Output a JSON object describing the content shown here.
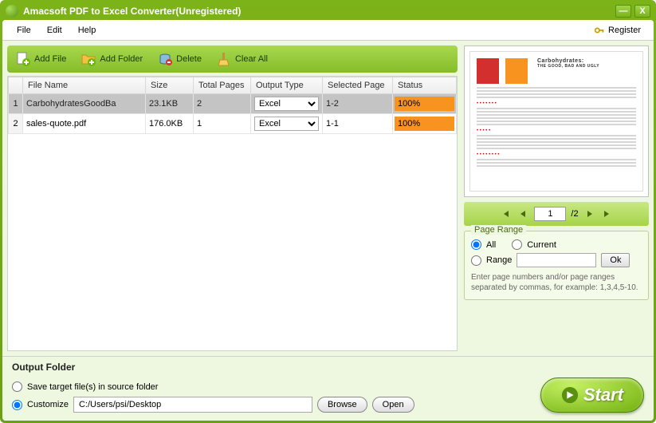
{
  "window": {
    "title": "Amacsoft PDF to Excel Converter(Unregistered)"
  },
  "menu": {
    "file": "File",
    "edit": "Edit",
    "help": "Help",
    "register": "Register"
  },
  "toolbar": {
    "add_file": "Add File",
    "add_folder": "Add Folder",
    "delete": "Delete",
    "clear_all": "Clear All"
  },
  "table": {
    "headers": {
      "filename": "File Name",
      "size": "Size",
      "total_pages": "Total Pages",
      "output_type": "Output Type",
      "selected_page": "Selected Page",
      "status": "Status"
    },
    "rows": [
      {
        "idx": "1",
        "filename": "CarbohydratesGoodBa",
        "size": "23.1KB",
        "pages": "2",
        "output": "Excel",
        "selected": "1-2",
        "status": "100%",
        "selected_row": true
      },
      {
        "idx": "2",
        "filename": "sales-quote.pdf",
        "size": "176.0KB",
        "pages": "1",
        "output": "Excel",
        "selected": "1-1",
        "status": "100%",
        "selected_row": false
      }
    ]
  },
  "preview": {
    "doc_title": "Carbohydrates:",
    "doc_subtitle": "THE GOOD, BAD AND UGLY"
  },
  "pager": {
    "current": "1",
    "total": "/2"
  },
  "page_range": {
    "legend": "Page Range",
    "all": "All",
    "current": "Current",
    "range": "Range",
    "ok": "Ok",
    "hint": "Enter page numbers and/or page ranges separated by commas, for example: 1,3,4,5-10."
  },
  "output": {
    "label": "Output Folder",
    "save_in_source": "Save target file(s) in source folder",
    "customize": "Customize",
    "path": "C:/Users/psi/Desktop",
    "browse": "Browse",
    "open": "Open",
    "start": "Start"
  }
}
